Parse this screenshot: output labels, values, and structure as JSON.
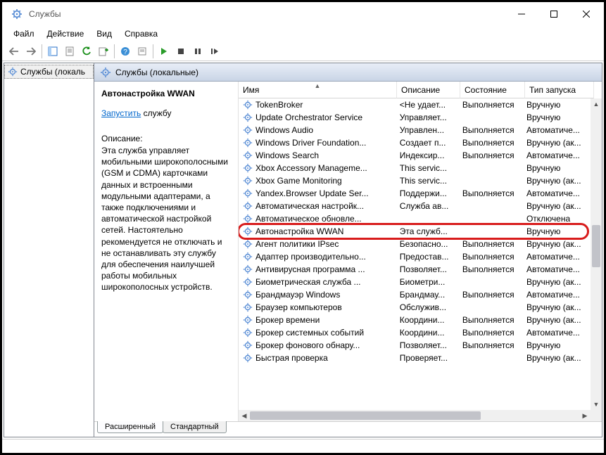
{
  "title": "Службы",
  "menu": {
    "file": "Файл",
    "action": "Действие",
    "view": "Вид",
    "help": "Справка"
  },
  "tree": {
    "root": "Службы (локаль"
  },
  "pane_header": "Службы (локальные)",
  "info": {
    "title": "Автонастройка WWAN",
    "start_link": "Запустить",
    "start_suffix": " службу",
    "desc_label": "Описание:",
    "desc_text": "Эта служба управляет мобильными широкополосными (GSM и CDMA) карточками данных и встроенными модульными адаптерами, а также подключениями и автоматической настройкой сетей. Настоятельно рекомендуется не отключать и не останавливать эту службу для обеспечения наилучшей работы мобильных широкополосных устройств."
  },
  "columns": {
    "name": "Имя",
    "desc": "Описание",
    "state": "Состояние",
    "start": "Тип запуска"
  },
  "rows": [
    {
      "name": "TokenBroker",
      "desc": "<Не удает...",
      "state": "Выполняется",
      "start": "Вручную"
    },
    {
      "name": "Update Orchestrator Service",
      "desc": "Управляет...",
      "state": "",
      "start": "Вручную"
    },
    {
      "name": "Windows Audio",
      "desc": "Управлен...",
      "state": "Выполняется",
      "start": "Автоматиче..."
    },
    {
      "name": "Windows Driver Foundation...",
      "desc": "Создает п...",
      "state": "Выполняется",
      "start": "Вручную (ак..."
    },
    {
      "name": "Windows Search",
      "desc": "Индексир...",
      "state": "Выполняется",
      "start": "Автоматиче..."
    },
    {
      "name": "Xbox Accessory Manageme...",
      "desc": "This servic...",
      "state": "",
      "start": "Вручную"
    },
    {
      "name": "Xbox Game Monitoring",
      "desc": "This servic...",
      "state": "",
      "start": "Вручную (ак..."
    },
    {
      "name": "Yandex.Browser Update Ser...",
      "desc": "Поддержи...",
      "state": "Выполняется",
      "start": "Автоматиче..."
    },
    {
      "name": "Автоматическая настройк...",
      "desc": "Служба ав...",
      "state": "",
      "start": "Вручную (ак..."
    },
    {
      "name": "Автоматическое обновле...",
      "desc": "",
      "state": "",
      "start": "Отключена"
    },
    {
      "name": "Автонастройка WWAN",
      "desc": "Эта служб...",
      "state": "",
      "start": "Вручную",
      "hl": true
    },
    {
      "name": "Агент политики IPsec",
      "desc": "Безопасно...",
      "state": "Выполняется",
      "start": "Вручную (ак..."
    },
    {
      "name": "Адаптер производительно...",
      "desc": "Предостав...",
      "state": "Выполняется",
      "start": "Автоматиче..."
    },
    {
      "name": "Антивирусная программа ...",
      "desc": "Позволяет...",
      "state": "Выполняется",
      "start": "Автоматиче..."
    },
    {
      "name": "Биометрическая служба ...",
      "desc": "Биометри...",
      "state": "",
      "start": "Вручную (ак..."
    },
    {
      "name": "Брандмауэр Windows",
      "desc": "Брандмау...",
      "state": "Выполняется",
      "start": "Автоматиче..."
    },
    {
      "name": "Браузер компьютеров",
      "desc": "Обслужив...",
      "state": "",
      "start": "Вручную (ак..."
    },
    {
      "name": "Брокер времени",
      "desc": "Координи...",
      "state": "Выполняется",
      "start": "Вручную (ак..."
    },
    {
      "name": "Брокер системных событий",
      "desc": "Координи...",
      "state": "Выполняется",
      "start": "Автоматиче..."
    },
    {
      "name": "Брокер фонового обнару...",
      "desc": "Позволяет...",
      "state": "Выполняется",
      "start": "Вручную"
    },
    {
      "name": "Быстрая проверка",
      "desc": "Проверяет...",
      "state": "",
      "start": "Вручную (ак..."
    }
  ],
  "tabs": {
    "extended": "Расширенный",
    "standard": "Стандартный"
  }
}
